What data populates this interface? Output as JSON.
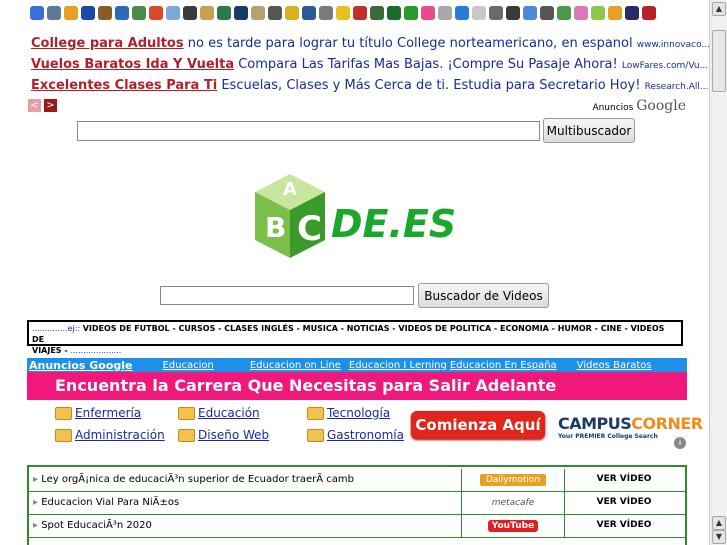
{
  "ads": [
    {
      "title": "College para Adultos",
      "desc": "no es tarde para lograr tu título College norteamericano, en espanol",
      "url": "www.innovaco..."
    },
    {
      "title": "Vuelos Baratos Ida Y Vuelta",
      "desc": "Compara Las Tarifas Mas Bajas. ¡Compre Su Pasaje Ahora!",
      "url": "LowFares.com/Vu..."
    },
    {
      "title": "Excelentes Clases Para Ti",
      "desc": "Escuelas, Clases y Más Cerca de ti. Estudia para Secretario Hoy!",
      "url": "Research.All..."
    }
  ],
  "ad_nav": {
    "prev": "<",
    "next": ">"
  },
  "anuncios": {
    "label": "Anuncios",
    "brand": "Google"
  },
  "multibuscador": {
    "button": "Multibuscador",
    "value": ""
  },
  "logo": {
    "text": "DE.ES",
    "letters": [
      "A",
      "B",
      "C"
    ]
  },
  "video_search": {
    "button": "Buscador de Videos",
    "value": ""
  },
  "categories": {
    "prefix_dots": "..............",
    "prefix": "ej:: ",
    "list": "VIDEOS DE FUTBOL - CURSOS - CLASES INGLÉS - MUSICA - NOTICIAS - VIDEOS DE POLITICA - ECONOMIA - HUMOR - CINE - VIDEOS DE",
    "list2": "VIAJES - ",
    "suffix_dots": "...................."
  },
  "google_ads_bar": {
    "header": "Anuncios Google",
    "links": [
      "Educacion",
      "Educacion on Line",
      "Educacion I Lerning",
      "Educacion En España",
      "Videos Baratos"
    ]
  },
  "banner": {
    "headline": "Encuentra la Carrera Que Necesitas para Salir Adelante",
    "courses": [
      "Enfermería",
      "Educación",
      "Tecnología",
      "Administración",
      "Diseño Web",
      "Gastronomía"
    ],
    "cta": "Comienza Aquí",
    "brand_campus": "CAMPUS",
    "brand_corner": "CORNER",
    "tagline": "Your PREMIER College Search",
    "info_icon": "i"
  },
  "videos": [
    {
      "title": "Ley orgÃ¡nica de educaciÃ³n superior de Ecuador traerÃ­ camb",
      "source": "Dailymotion",
      "action": "VER VÍDEO"
    },
    {
      "title": "Educacion Vial Para NiÃ±os",
      "source": "metacafe",
      "action": "VER VÍDEO"
    },
    {
      "title": "Spot EducaciÃ³n 2020",
      "source": "YouTube",
      "action": "VER VÍDEO"
    }
  ],
  "colors": {
    "ad_title": "#b0202a",
    "link": "#1a2a9a",
    "pink": "#f0187a",
    "blue_bar": "#1e90e8",
    "cta": "#e0251b",
    "table_border": "#2e8b2e"
  }
}
